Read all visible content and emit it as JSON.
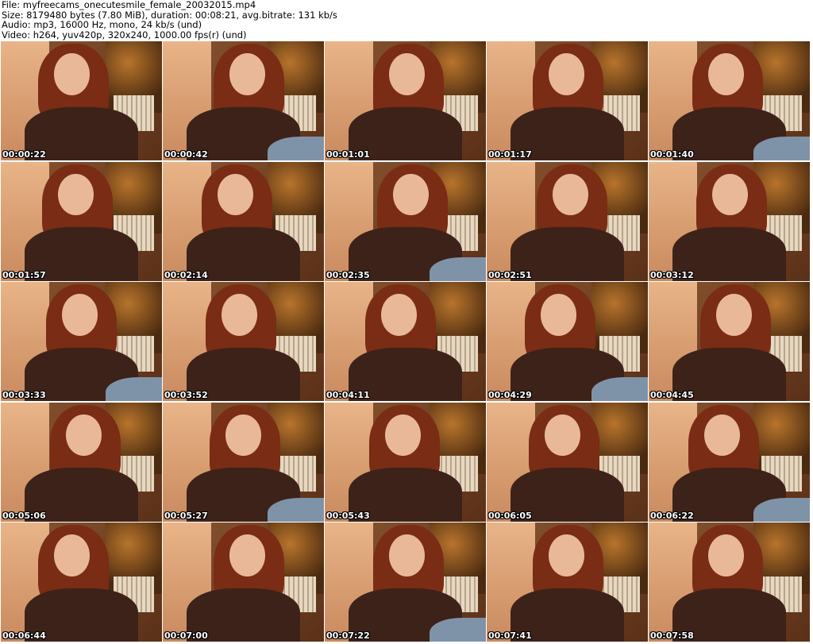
{
  "header": {
    "file": "File: myfreecams_onecutesmile_female_20032015.mp4",
    "size": "Size: 8179480 bytes (7.80 MiB), duration: 00:08:21, avg.bitrate: 131 kb/s",
    "audio": "Audio: mp3, 16000 Hz, mono, 24 kb/s (und)",
    "video": "Video: h264, yuv420p, 320x240, 1000.00 fps(r) (und)"
  },
  "thumbnails": [
    "00:00:22",
    "00:00:42",
    "00:01:01",
    "00:01:17",
    "00:01:40",
    "00:01:57",
    "00:02:14",
    "00:02:35",
    "00:02:51",
    "00:03:12",
    "00:03:33",
    "00:03:52",
    "00:04:11",
    "00:04:29",
    "00:04:45",
    "00:05:06",
    "00:05:27",
    "00:05:43",
    "00:06:05",
    "00:06:22",
    "00:06:44",
    "00:07:00",
    "00:07:22",
    "00:07:41",
    "00:07:58"
  ]
}
